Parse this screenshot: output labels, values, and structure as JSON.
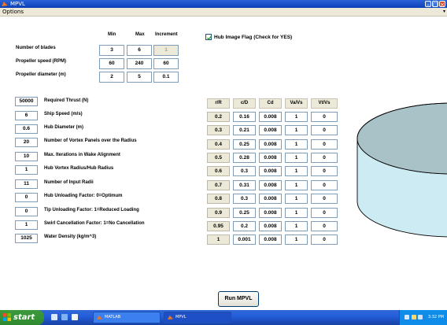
{
  "window": {
    "title": "MPVL"
  },
  "menu": {
    "options": "Options",
    "overflow": "▾"
  },
  "param_header": {
    "min": "Min",
    "max": "Max",
    "increment": "Increment"
  },
  "param_rows": [
    {
      "label": "Number of blades",
      "min": "3",
      "max": "6",
      "increment": "1"
    },
    {
      "label": "Propeller speed (RPM)",
      "min": "60",
      "max": "240",
      "increment": "60"
    },
    {
      "label": "Propeller diameter (m)",
      "min": "2",
      "max": "5",
      "increment": "0.1"
    }
  ],
  "hub_flag": {
    "label": "Hub Image Flag (Check for YES)",
    "checked": true
  },
  "inputs": [
    {
      "value": "50000",
      "label": "Required Thrust (N)"
    },
    {
      "value": "6",
      "label": "Ship Speed (m/s)"
    },
    {
      "value": "0.6",
      "label": "Hub Diameter (m)"
    },
    {
      "value": "20",
      "label": "Number of Vortex Panels over the Radius"
    },
    {
      "value": "10",
      "label": "Max. Iterations in Wake Alignment"
    },
    {
      "value": "1",
      "label": "Hub Vortex Radius/Hub Radius"
    },
    {
      "value": "11",
      "label": "Number of Input Radii"
    },
    {
      "value": "0",
      "label": "Hub Unloading Factor: 0=Optimum"
    },
    {
      "value": "0",
      "label": "Tip Unloading Factor: 1=Reduced Loading"
    },
    {
      "value": "1",
      "label": "Swirl Cancellation Factor: 1=No Cancellation"
    },
    {
      "value": "1025",
      "label": "Water Density (kg/m^3)"
    }
  ],
  "table_headers": [
    "r/R",
    "c/D",
    "Cd",
    "Va/Vs",
    "Vt/Vs"
  ],
  "table_rows": [
    [
      "0.2",
      "0.16",
      "0.008",
      "1",
      "0"
    ],
    [
      "0.3",
      "0.21",
      "0.008",
      "1",
      "0"
    ],
    [
      "0.4",
      "0.25",
      "0.008",
      "1",
      "0"
    ],
    [
      "0.5",
      "0.28",
      "0.008",
      "1",
      "0"
    ],
    [
      "0.6",
      "0.3",
      "0.008",
      "1",
      "0"
    ],
    [
      "0.7",
      "0.31",
      "0.008",
      "1",
      "0"
    ],
    [
      "0.8",
      "0.3",
      "0.008",
      "1",
      "0"
    ],
    [
      "0.9",
      "0.25",
      "0.008",
      "1",
      "0"
    ],
    [
      "0.95",
      "0.2",
      "0.008",
      "1",
      "0"
    ],
    [
      "1",
      "0.001",
      "0.008",
      "1",
      "0"
    ]
  ],
  "run_button": "Run MPVL",
  "taskbar": {
    "start": "start",
    "tasks": [
      {
        "label": "MATLAB"
      },
      {
        "label": "MPVL"
      }
    ],
    "clock": "3:32 PM"
  },
  "colors": {
    "titlebar": "#0A3FB8",
    "cylinder_top": "#A9C2C8",
    "cylinder_side": "#CDEBF2",
    "start_green": "#2F8A2F"
  }
}
